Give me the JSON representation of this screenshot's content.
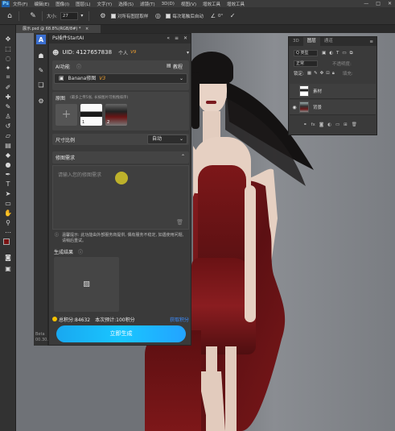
{
  "menubar": {
    "logo": "Ps",
    "items": [
      "文件(F)",
      "编辑(E)",
      "图像(I)",
      "图层(L)",
      "文字(Y)",
      "选择(S)",
      "滤镜(T)",
      "3D(D)",
      "视图(V)",
      "增效工具",
      "增效工具"
    ],
    "window_controls": [
      "—",
      "□",
      "✕"
    ]
  },
  "optbar": {
    "size_label": "大小:",
    "size_value": "27",
    "sample_all_label": "对所有图层取样",
    "auto_erase_label": "每次笔触后自动",
    "angle_label": "∠",
    "angle_value": "0°"
  },
  "doc_tab": {
    "title": "展示.psd @ 68.8%(RGB/8#) *",
    "close": "×"
  },
  "plugin": {
    "title": "Ps插件StartAI",
    "uid_label": "UID: 4127657838",
    "account_type": "个人",
    "vip_badge": "V9",
    "ai_function_label": "AI功能",
    "tutorial_label": "教程",
    "function_value": "Banana修图",
    "function_version": "V3",
    "original_label": "原图",
    "original_hint": "(最多上传5张, 长按图片可拖拽排序)",
    "image_indices": [
      "1",
      "2"
    ],
    "ratio_label": "尺寸比例",
    "ratio_value": "自动",
    "edit_request_label": "修图需求",
    "textarea_placeholder": "请输入您的修图需求",
    "warning_text": "温馨提示: 此功能由外部服务商提供, 偶有服务不稳定, 如遇使用问题, 请稍后重试。",
    "result_label": "生成结果",
    "points_total": "总积分:84632",
    "points_estimate": "本次预计:100积分",
    "get_points": "获取积分",
    "generate_button": "立即生成",
    "footnote": "Beta\n00.30.b"
  },
  "layers": {
    "tabs": [
      "3D",
      "图层",
      "通道"
    ],
    "filter_label": "Q 类型",
    "blend_mode": "正常",
    "opacity_label": "不透明度:",
    "lock_label": "锁定:",
    "fill_label": "填充:",
    "layer_items": [
      {
        "name": "素材"
      },
      {
        "name": "背景"
      }
    ],
    "footer_icons": [
      "link-icon",
      "fx-icon",
      "mask-icon",
      "adjustment-icon",
      "group-icon",
      "new-layer-icon",
      "trash-icon"
    ]
  },
  "colors": {
    "accent": "#19b6ff",
    "points_gold": "#f6c200",
    "get_points_blue": "#3c8dff",
    "vip_orange": "#f0a030",
    "foreground_swatch": "#7a1414",
    "background_swatch": "#ffffff"
  }
}
